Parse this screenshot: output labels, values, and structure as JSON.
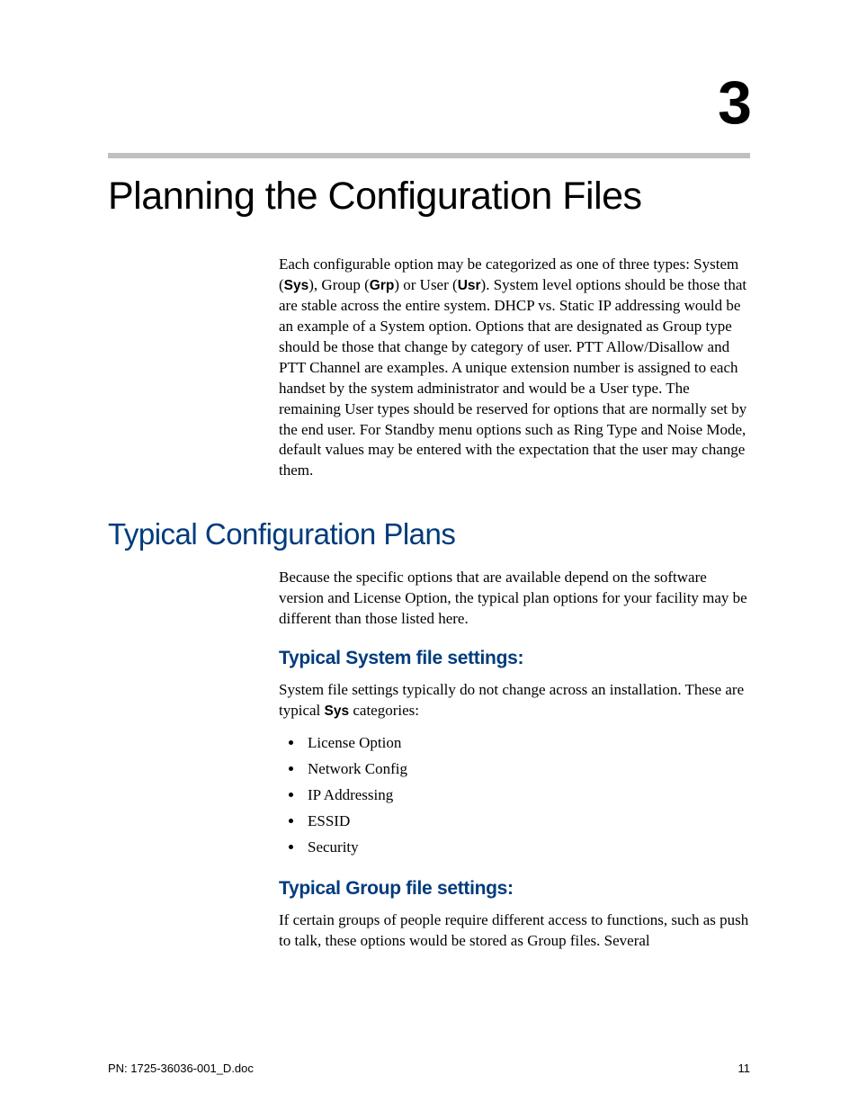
{
  "chapter": {
    "number": "3",
    "title": "Planning the Configuration Files",
    "intro": "Each configurable option may be categorized as one of three types: System (",
    "intro_sys": "Sys",
    "intro_mid1": "), Group (",
    "intro_grp": "Grp",
    "intro_mid2": ") or User (",
    "intro_usr": "Usr",
    "intro_rest": "). System level options should be those that are stable across the entire system. DHCP vs. Static IP addressing would be an example of a System option. Options that are designated as Group type should be those that change by category of user. PTT Allow/Disallow and PTT Channel are examples. A unique extension number is assigned to each handset by the system administrator and would be a User type. The remaining User types should be reserved for options that are normally set by the end user. For Standby menu options such as Ring Type and Noise Mode, default values may be entered with the expectation that the user may change them."
  },
  "section": {
    "heading": "Typical Configuration Plans",
    "intro": "Because the specific options that are available depend on the software version and License Option, the typical plan options for your facility may be different than those listed here."
  },
  "sysfile": {
    "heading": "Typical System file settings:",
    "intro_a": "System file settings typically do not change across an installation. These are typical ",
    "intro_bold": "Sys",
    "intro_b": " categories:",
    "items": [
      "License Option",
      "Network Config",
      "IP Addressing",
      "ESSID",
      "Security"
    ]
  },
  "groupfile": {
    "heading": "Typical Group file settings:",
    "intro": "If certain groups of people require different access to functions, such as push to talk, these options would be stored as Group files. Several"
  },
  "footer": {
    "doc": "PN: 1725-36036-001_D.doc",
    "page": "11"
  }
}
